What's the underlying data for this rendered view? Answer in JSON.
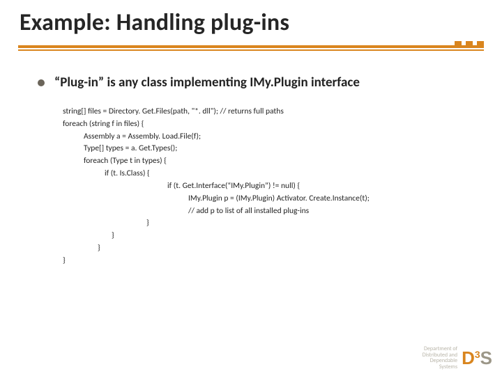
{
  "title": "Example: Handling plug-ins",
  "bullet": "“Plug-in” is any class implementing IMy.Plugin interface",
  "code": {
    "l1": "string[] files = Directory. Get.Files(path, \"*. dll\"); // returns full paths",
    "l2": "foreach (string f in files) {",
    "l3": "Assembly a = Assembly. Load.File(f);",
    "l4": "Type[] types = a. Get.Types();",
    "l5": "foreach (Type t in types) {",
    "l6": "if (t. Is.Class) {",
    "l7": "if (t. Get.Interface(“IMy.Plugin”) != null) {",
    "l8": "IMy.Plugin p = (IMy.Plugin) Activator. Create.Instance(t);",
    "l9": "// add p to list of all installed plug-ins",
    "l10": "}",
    "l11": "}",
    "l12": "}",
    "l13": "}"
  },
  "footer": {
    "line1": "Department of",
    "line2": "Distributed and",
    "line3": "Dependable",
    "line4": "Systems",
    "logo_d": "D",
    "logo_3": "3",
    "logo_s": "S"
  }
}
